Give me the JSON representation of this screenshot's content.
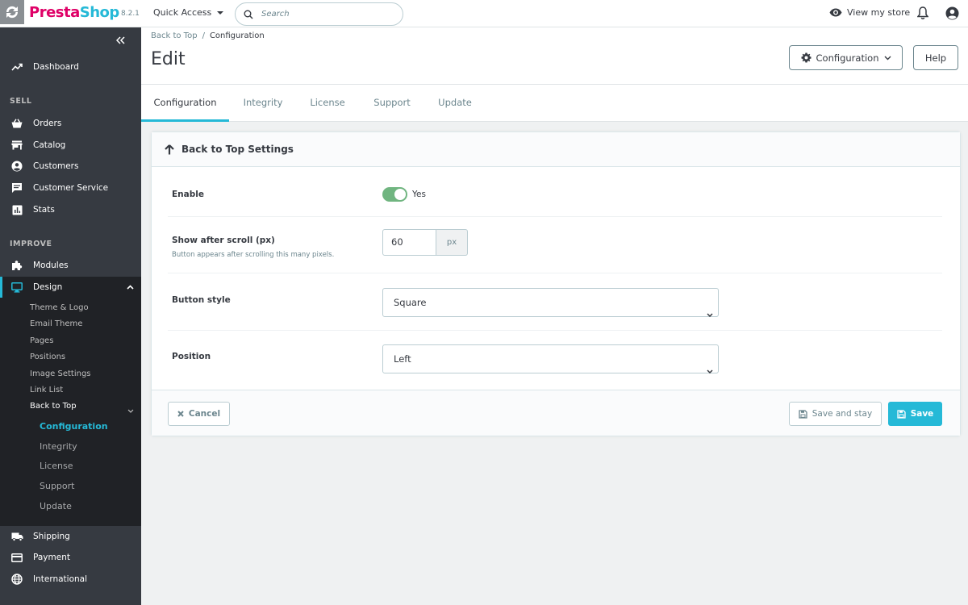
{
  "header": {
    "logo_prefix": "Presta",
    "logo_suffix": "Shop",
    "version": "8.2.1",
    "quick_access": "Quick Access",
    "search_placeholder": "Search",
    "view_store": "View my store",
    "icons": [
      "eye-icon",
      "bell-icon",
      "user-icon",
      "search-icon"
    ]
  },
  "sidebar": {
    "items": [
      {
        "label": "Dashboard",
        "icon": "trending-up-icon"
      },
      {
        "label": "Orders",
        "icon": "basket-icon"
      },
      {
        "label": "Catalog",
        "icon": "store-icon"
      },
      {
        "label": "Customers",
        "icon": "account-circle-icon"
      },
      {
        "label": "Customer Service",
        "icon": "chat-icon"
      },
      {
        "label": "Stats",
        "icon": "chart-icon"
      },
      {
        "label": "Modules",
        "icon": "puzzle-icon"
      },
      {
        "label": "Design",
        "icon": "desktop-icon"
      },
      {
        "label": "Shipping",
        "icon": "truck-icon"
      },
      {
        "label": "Payment",
        "icon": "credit-card-icon"
      },
      {
        "label": "International",
        "icon": "globe-icon"
      }
    ],
    "sections": {
      "sell": "SELL",
      "improve": "IMPROVE"
    },
    "design_submenu": [
      "Theme & Logo",
      "Email Theme",
      "Pages",
      "Positions",
      "Image Settings",
      "Link List",
      "Back to Top"
    ],
    "back_to_top_submenu": [
      "Configuration",
      "Integrity",
      "License",
      "Support",
      "Update"
    ],
    "active_color": "#25b9d7"
  },
  "page": {
    "breadcrumb": [
      "Back to Top",
      "Configuration"
    ],
    "title": "Edit",
    "config_button": "Configuration",
    "help_button": "Help"
  },
  "tabs": [
    "Configuration",
    "Integrity",
    "License",
    "Support",
    "Update"
  ],
  "panel": {
    "title": "Back to Top Settings",
    "enable_label": "Enable",
    "enable_value": "Yes",
    "scroll_label": "Show after scroll (px)",
    "scroll_help": "Button appears after scrolling this many pixels.",
    "scroll_value": "60",
    "scroll_unit": "px",
    "style_label": "Button style",
    "style_value": "Square",
    "position_label": "Position",
    "position_value": "Left",
    "cancel": "Cancel",
    "save_stay": "Save and stay",
    "save": "Save"
  }
}
